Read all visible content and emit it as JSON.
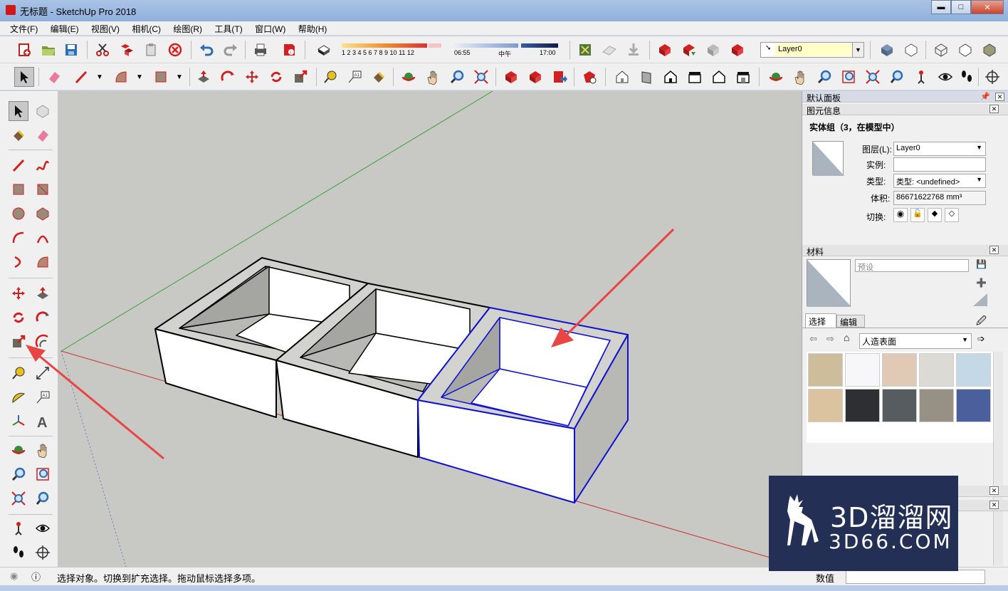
{
  "window": {
    "title": "无标题 - SketchUp Pro 2018",
    "buttons": {
      "minimize": "▬",
      "maximize": "□",
      "close": "✕"
    }
  },
  "menu": {
    "items": [
      "文件(F)",
      "编辑(E)",
      "视图(V)",
      "相机(C)",
      "绘图(R)",
      "工具(T)",
      "窗口(W)",
      "帮助(H)"
    ]
  },
  "toolbar": {
    "shadow_months": "1 2 3 4 5 6 7 8 9 10 11 12",
    "time_start": "06:55",
    "time_mid": "中午",
    "time_end": "17:00",
    "layer_value": "Layer0"
  },
  "panel": {
    "title": "默认面板",
    "entity_info": {
      "header": "图元信息",
      "entity_title": "实体组（3，在模型中）",
      "layer_label": "图层(L):",
      "layer_value": "Layer0",
      "instance_label": "实例:",
      "instance_value": "",
      "type_label": "类型:",
      "type_value": "类型: <undefined>",
      "volume_label": "体积:",
      "volume_value": "86671622768 mm³",
      "toggle_label": "切换:"
    },
    "materials": {
      "header": "材料",
      "name_placeholder": "预设",
      "tabs": [
        "选择",
        "编辑"
      ],
      "category": "人造表面",
      "swatches": [
        "#cdbd9b",
        "#f7f7f9",
        "#e0c9b5",
        "#dcdad5",
        "#c4d8e6",
        "#dcc3a0",
        "#2d2f33",
        "#575c61",
        "#979185",
        "#4a5f9c"
      ]
    }
  },
  "statusbar": {
    "message": "选择对象。切换到扩充选择。拖动鼠标选择多项。",
    "value_label": "数值",
    "value": ""
  },
  "watermark": {
    "line1": "3D溜溜网",
    "line2": "3D66.COM"
  },
  "colors": {
    "selection_blue": "#1010d0",
    "annotation_arrow": "#e84545",
    "axis_red": "#c83232",
    "axis_green": "#3ca03c"
  }
}
